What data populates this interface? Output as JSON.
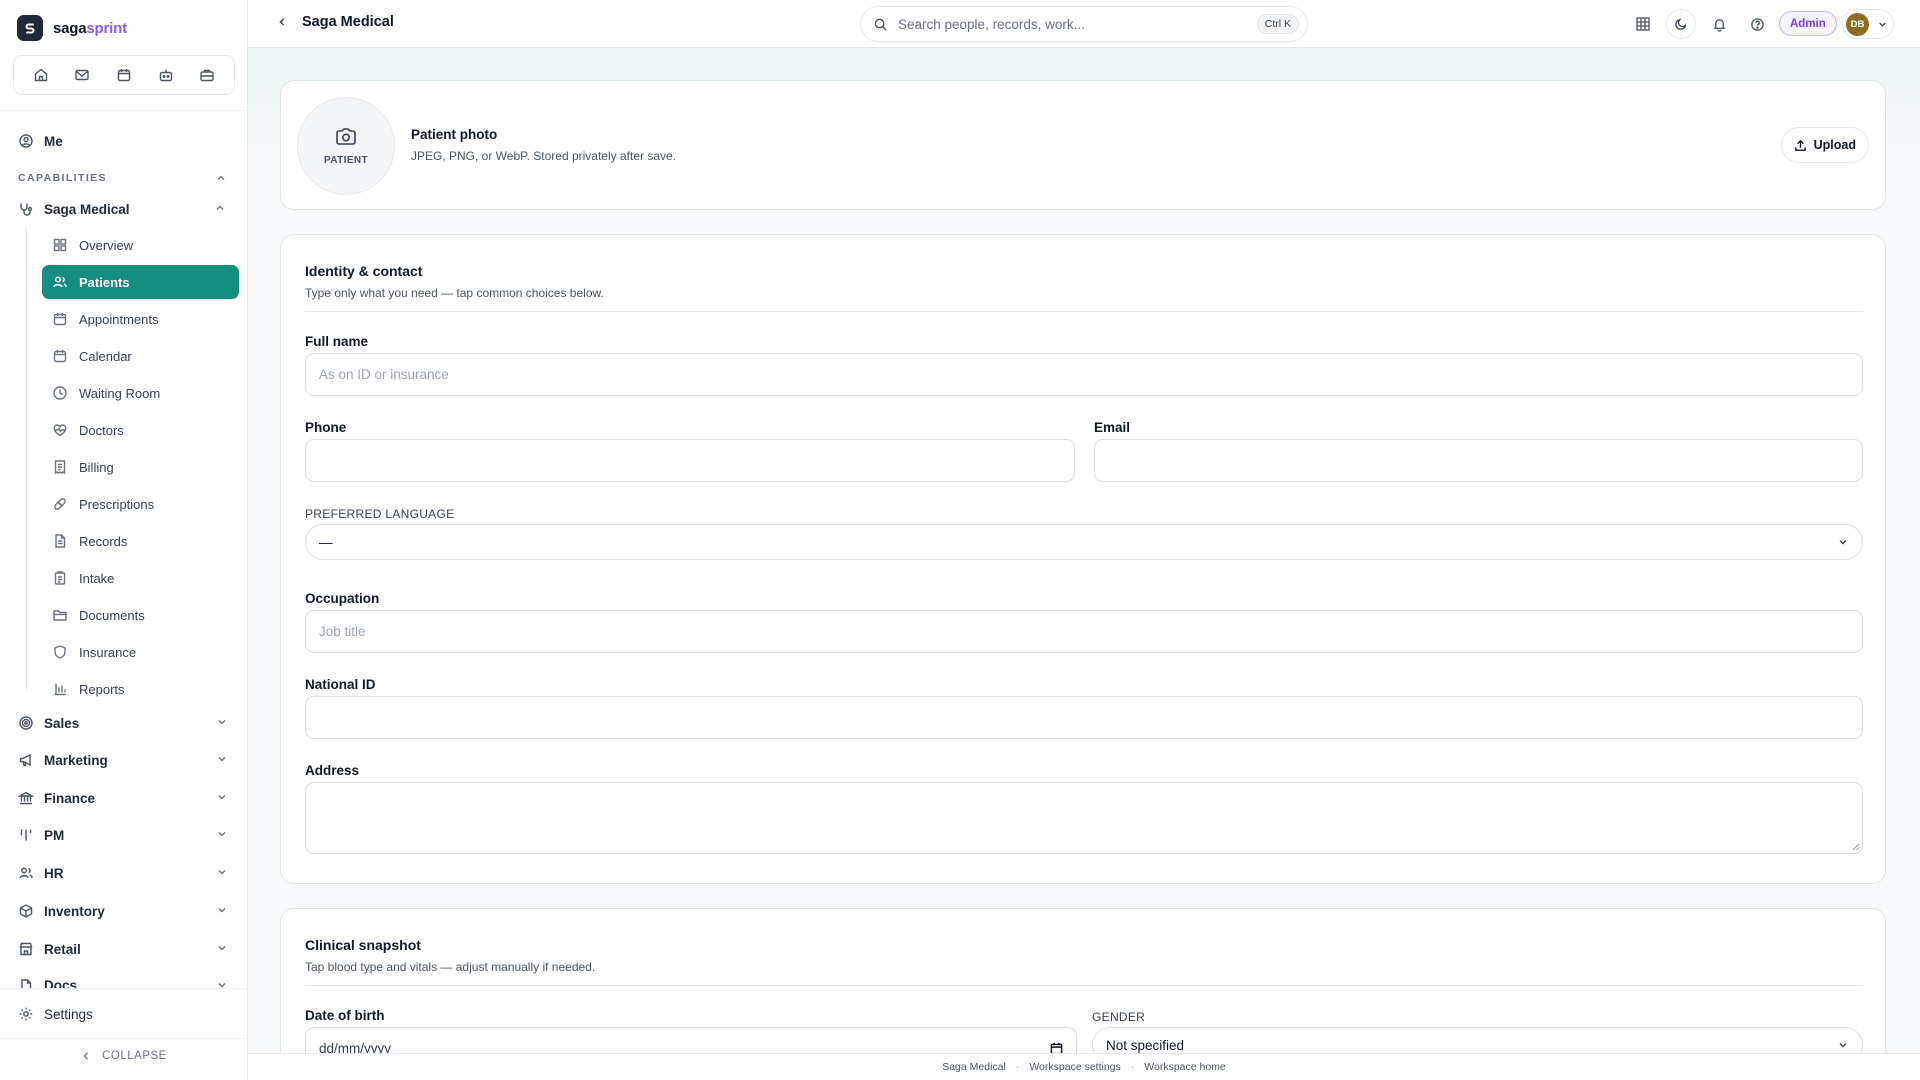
{
  "brand": {
    "name_main": "saga",
    "name_accent": "sprint"
  },
  "sidebar": {
    "me": "Me",
    "capabilities_heading": "CAPABILITIES",
    "current_capability": "Saga Medical",
    "sub_items": [
      {
        "label": "Overview",
        "icon": "grid-icon"
      },
      {
        "label": "Patients",
        "icon": "users-icon",
        "active": true
      },
      {
        "label": "Appointments",
        "icon": "calendar-icon"
      },
      {
        "label": "Calendar",
        "icon": "calendar-icon"
      },
      {
        "label": "Waiting Room",
        "icon": "clock-icon"
      },
      {
        "label": "Doctors",
        "icon": "heart-pulse-icon"
      },
      {
        "label": "Billing",
        "icon": "receipt-icon"
      },
      {
        "label": "Prescriptions",
        "icon": "pill-icon"
      },
      {
        "label": "Records",
        "icon": "file-text-icon"
      },
      {
        "label": "Intake",
        "icon": "clipboard-icon"
      },
      {
        "label": "Documents",
        "icon": "folder-icon"
      },
      {
        "label": "Insurance",
        "icon": "shield-icon"
      },
      {
        "label": "Reports",
        "icon": "bar-chart-icon"
      }
    ],
    "groups": [
      {
        "label": "Sales",
        "icon": "target-icon"
      },
      {
        "label": "Marketing",
        "icon": "megaphone-icon"
      },
      {
        "label": "Finance",
        "icon": "bank-icon"
      },
      {
        "label": "PM",
        "icon": "kanban-icon"
      },
      {
        "label": "HR",
        "icon": "users-icon"
      },
      {
        "label": "Inventory",
        "icon": "box-icon"
      },
      {
        "label": "Retail",
        "icon": "store-icon"
      },
      {
        "label": "Docs",
        "icon": "file-icon"
      }
    ],
    "settings": "Settings",
    "collapse": "COLLAPSE"
  },
  "header": {
    "breadcrumb": "Saga Medical",
    "search_placeholder": "Search people, records, work...",
    "search_shortcut": "Ctrl K",
    "role_badge": "Admin",
    "avatar_initials": "DB"
  },
  "photo": {
    "circle_label": "PATIENT",
    "title": "Patient photo",
    "subtitle": "JPEG, PNG, or WebP. Stored privately after save.",
    "upload_label": "Upload"
  },
  "identity": {
    "title": "Identity & contact",
    "subtitle": "Type only what you need — tap common choices below.",
    "full_name_label": "Full name",
    "full_name_placeholder": "As on ID or insurance",
    "phone_label": "Phone",
    "email_label": "Email",
    "language_label": "PREFERRED LANGUAGE",
    "language_value": "—",
    "occupation_label": "Occupation",
    "occupation_placeholder": "Job title",
    "national_id_label": "National ID",
    "address_label": "Address"
  },
  "clinical": {
    "title": "Clinical snapshot",
    "subtitle": "Tap blood type and vitals — adjust manually if needed.",
    "dob_label": "Date of birth",
    "dob_placeholder": "dd/mm/yyyy",
    "gender_label": "GENDER",
    "gender_value": "Not specified"
  },
  "footer": {
    "links": [
      "Saga Medical",
      "Workspace settings",
      "Workspace home"
    ]
  },
  "colors": {
    "accent": "#148f7f",
    "admin": "#7c3aed",
    "avatar": "#8a6d1f"
  }
}
